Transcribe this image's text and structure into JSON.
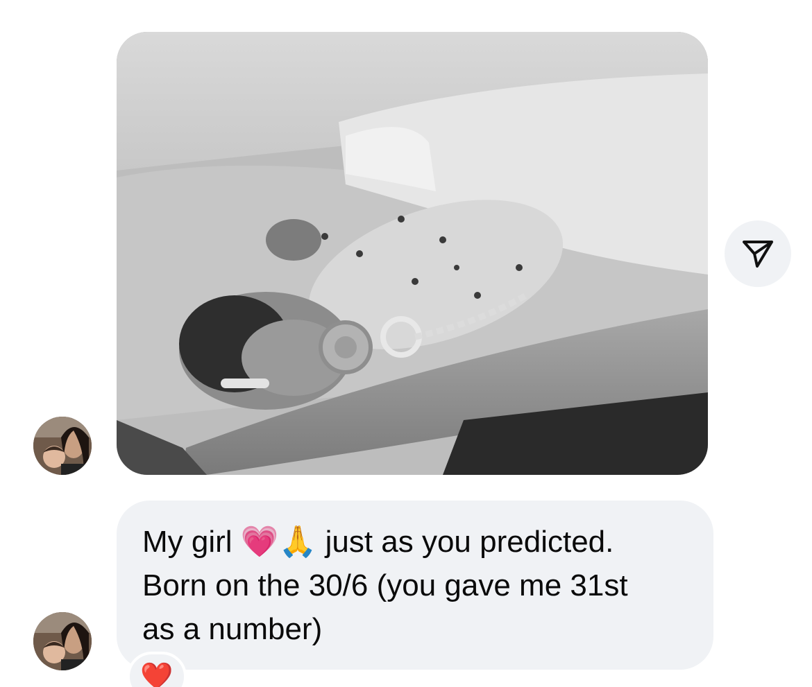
{
  "conversation": {
    "photo_message": {
      "sender_avatar": "avatar-photo",
      "image_description_icon": "photo-attachment-icon"
    },
    "share_button": {
      "icon": "paper-plane-icon"
    },
    "text_message": {
      "sender_avatar": "avatar-photo",
      "text": "My girl 💗🙏 just as you predicted.\nBorn on the 30/6 (you gave me 31st\nas a number)"
    },
    "reaction": {
      "emoji": "❤️"
    }
  },
  "colors": {
    "bubble_background": "#f0f2f5",
    "text": "#0a0a0a",
    "reaction_heart": "#ff2b45"
  }
}
